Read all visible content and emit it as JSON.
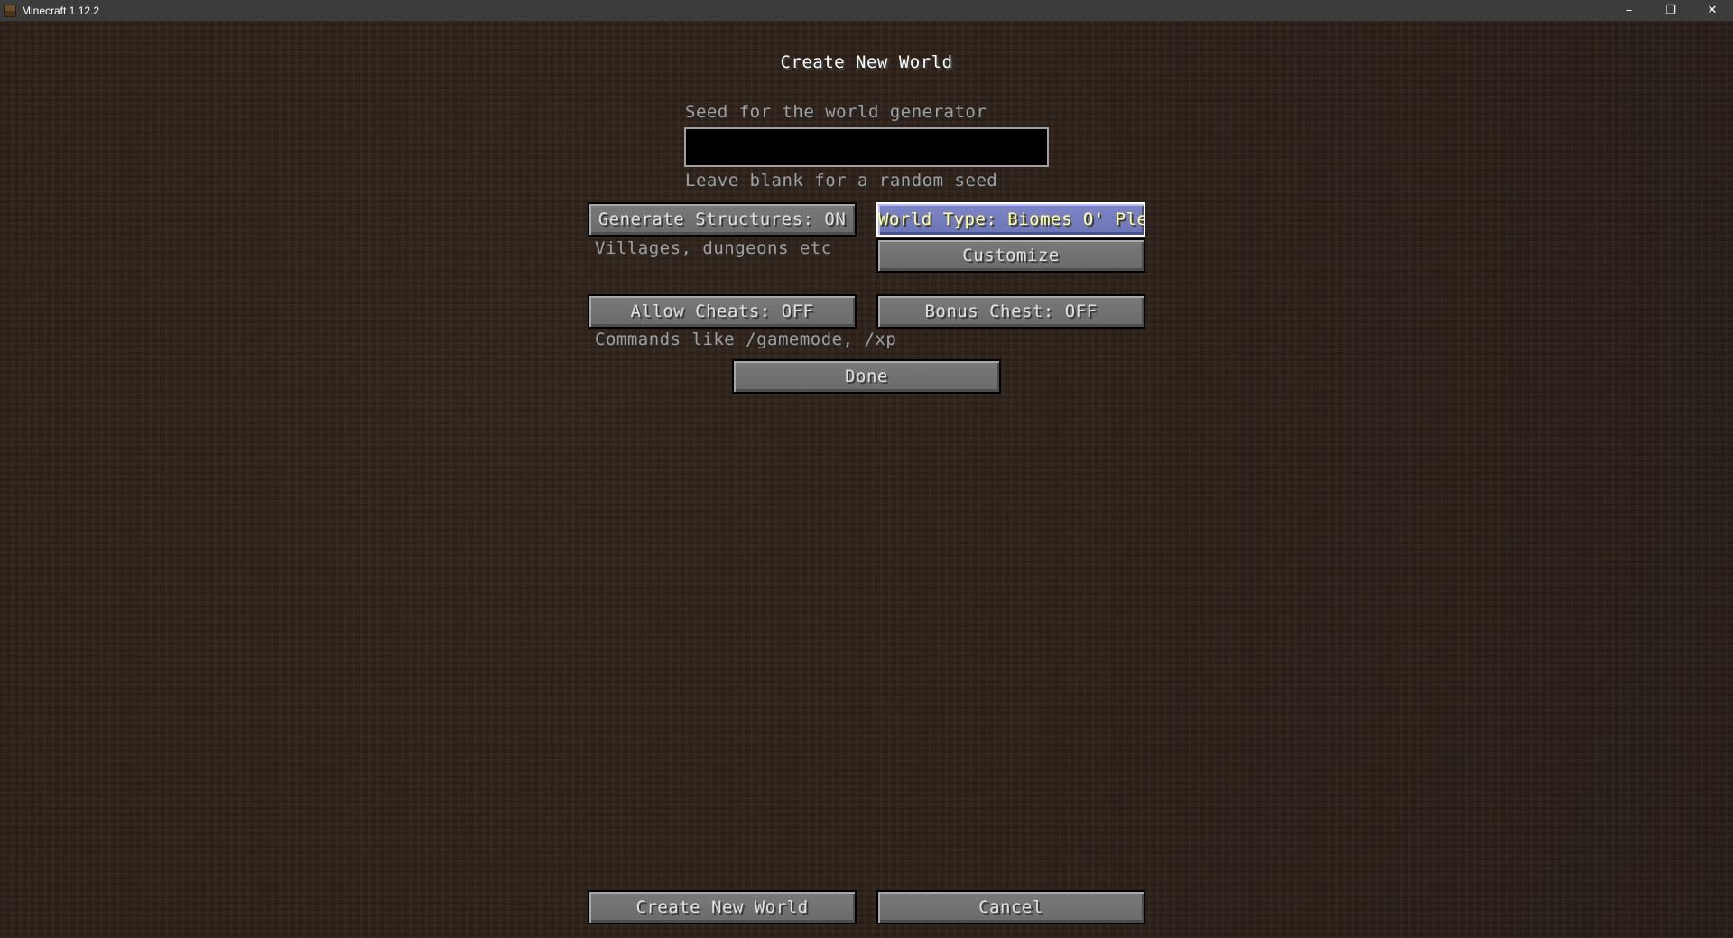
{
  "window": {
    "title": "Minecraft 1.12.2",
    "minimize": "–",
    "restore": "❐",
    "close": "✕"
  },
  "screen": {
    "heading": "Create New World",
    "seed_label": "Seed for the world generator",
    "seed_value": "",
    "seed_hint": "Leave blank for a random seed",
    "generate_structures": "Generate Structures: ON",
    "generate_structures_hint": "Villages, dungeons etc",
    "world_type": "World Type: Biomes O' Plenty",
    "customize": "Customize",
    "allow_cheats": "Allow Cheats: OFF",
    "allow_cheats_hint": "Commands like /gamemode, /xp",
    "bonus_chest": "Bonus Chest: OFF",
    "done": "Done",
    "create_world": "Create New World",
    "cancel": "Cancel"
  },
  "colors": {
    "hover_button": "#7e86c8",
    "hover_text": "#ffffa0",
    "button": "#6f6f6f",
    "label": "#a0a0a0"
  }
}
